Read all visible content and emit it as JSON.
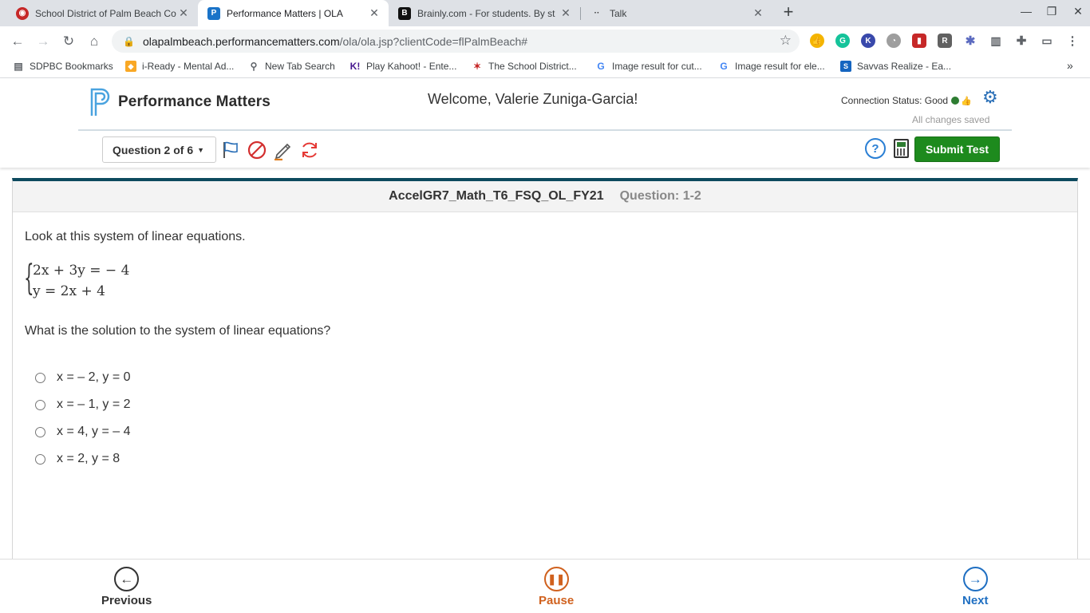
{
  "browser": {
    "tabs": [
      {
        "title": "School District of Palm Beach Co",
        "favicon": "sdpbc-icon"
      },
      {
        "title": "Performance Matters | OLA",
        "favicon": "performance-matters-icon"
      },
      {
        "title": "Brainly.com - For students. By st",
        "favicon": "brainly-icon"
      },
      {
        "title": "Talk",
        "favicon": "talk-icon"
      }
    ],
    "url_host": "olapalmbeach.performancematters.com",
    "url_path": "/ola/ola.jsp?clientCode=flPalmBeach#",
    "bookmarks": [
      "SDPBC Bookmarks",
      "i-Ready - Mental Ad...",
      "New Tab Search",
      "Play Kahoot! - Ente...",
      "The School District...",
      "Image result for cut...",
      "Image result for ele...",
      "Savvas Realize - Ea..."
    ],
    "more_bookmarks": "»"
  },
  "app": {
    "logo_text": "Performance Matters",
    "welcome": "Welcome, Valerie Zuniga-Garcia!",
    "connection_status": "Connection Status: Good",
    "save_status": "All changes saved",
    "question_select": "Question 2 of 6",
    "submit_label": "Submit Test",
    "help_label": "?",
    "accent_blue": "#2a7fd4",
    "submit_green": "#1d8a1d"
  },
  "question": {
    "test_name": "AccelGR7_Math_T6_FSQ_OL_FY21",
    "question_label": "Question: 1-2",
    "stem": "Look at this system of linear equations.",
    "equations": [
      "2x + 3y = − 4",
      "y = 2x + 4"
    ],
    "prompt": "What is the solution to the system of linear equations?",
    "options": [
      "x = – 2, y = 0",
      "x = – 1, y = 2",
      "x = 4, y = – 4",
      "x = 2, y = 8"
    ]
  },
  "footer": {
    "previous": "Previous",
    "pause": "Pause",
    "next": "Next"
  }
}
